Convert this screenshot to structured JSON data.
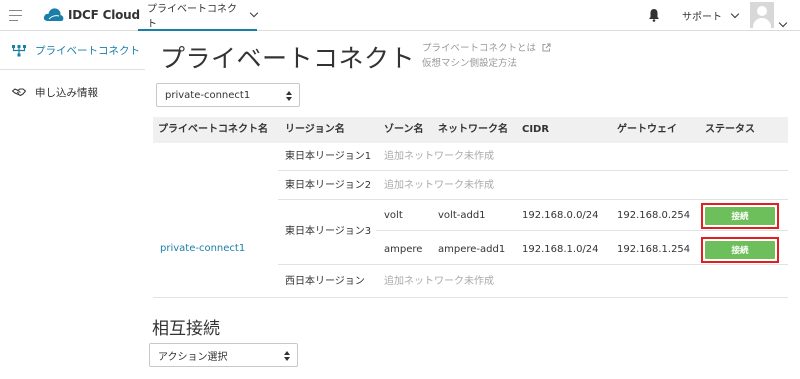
{
  "topbar": {
    "logo_text": "IDCF Cloud",
    "active_tab": "プライベートコネクト",
    "support_label": "サポート"
  },
  "sidebar": {
    "items": [
      {
        "label": "プライベートコネクト"
      },
      {
        "label": "申し込み情報"
      }
    ]
  },
  "main": {
    "title": "プライベートコネクト",
    "help_link_1": "プライベートコネクトとは",
    "help_link_2": "仮想マシン側設定方法",
    "selector_value": "private-connect1",
    "table": {
      "headers": [
        "プライベートコネクト名",
        "リージョン名",
        "ゾーン名",
        "ネットワーク名",
        "CIDR",
        "ゲートウェイ",
        "ステータス"
      ],
      "connect_name": "private-connect1",
      "rows": [
        {
          "region": "東日本リージョン1",
          "note": "追加ネットワーク未作成"
        },
        {
          "region": "東日本リージョン2",
          "note": "追加ネットワーク未作成"
        },
        {
          "region": "東日本リージョン3"
        },
        {
          "region": "西日本リージョン",
          "note": "追加ネットワーク未作成"
        }
      ],
      "networks": [
        {
          "zone": "volt",
          "network": "volt-add1",
          "cidr": "192.168.0.0/24",
          "gateway": "192.168.0.254",
          "status": "接続"
        },
        {
          "zone": "ampere",
          "network": "ampere-add1",
          "cidr": "192.168.1.0/24",
          "gateway": "192.168.1.254",
          "status": "接続"
        }
      ]
    },
    "section_title": "相互接続",
    "action_select_value": "アクション選択"
  },
  "colors": {
    "link": "#1a7fa8",
    "status_button": "#6cbf5a",
    "highlight_border": "#e02020"
  }
}
